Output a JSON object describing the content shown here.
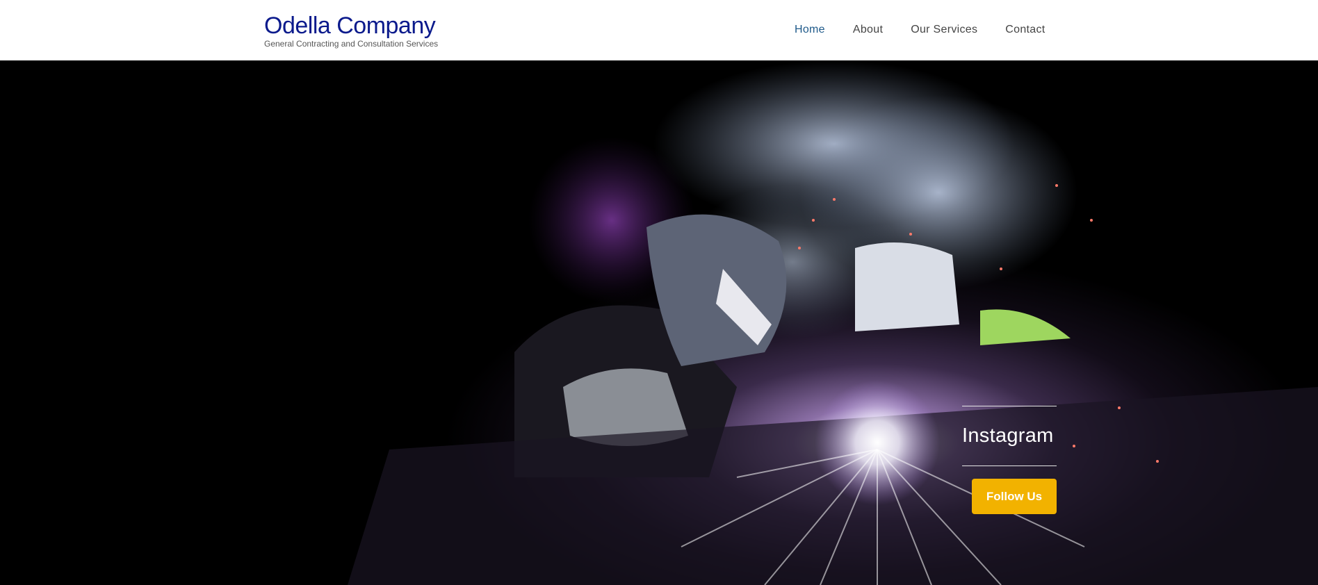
{
  "brand": {
    "title": "Odella Company",
    "tagline": "General Contracting and Consultation Services"
  },
  "nav": {
    "items": [
      {
        "label": "Home"
      },
      {
        "label": "About"
      },
      {
        "label": "Our Services"
      },
      {
        "label": "Contact"
      }
    ],
    "active_index": 0
  },
  "hero": {
    "image": "welder-sparks-photo",
    "social_label": "Instagram",
    "button_label": "Follow Us"
  },
  "colors": {
    "brand": "#0b1a8c",
    "accent": "#f2b200",
    "nav_active": "#1f5a8a"
  }
}
